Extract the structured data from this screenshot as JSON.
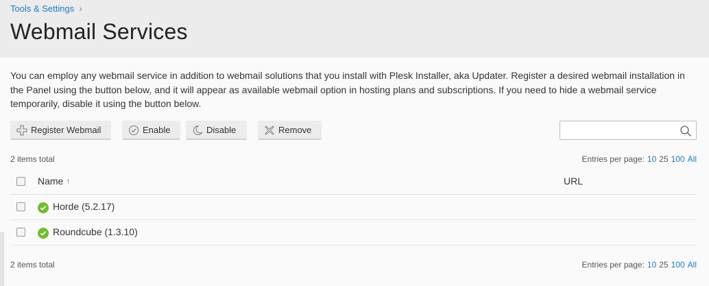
{
  "breadcrumb": {
    "items": [
      "Tools & Settings"
    ]
  },
  "page": {
    "title": "Webmail Services"
  },
  "description": "You can employ any webmail service in addition to webmail solutions that you install with Plesk Installer, aka Updater. Register a desired webmail installation in the Panel using the button below, and it will appear as available webmail option in hosting plans and subscriptions. If you need to hide a webmail service temporarily, disable it using the button below.",
  "toolbar": {
    "register_label": "Register Webmail",
    "enable_label": "Enable",
    "disable_label": "Disable",
    "remove_label": "Remove"
  },
  "search": {
    "value": "",
    "placeholder": ""
  },
  "list": {
    "total_text": "2 items total",
    "per_page_label": "Entries per page:",
    "per_page_options": [
      "10",
      "25",
      "100",
      "All"
    ],
    "columns": {
      "name": "Name",
      "name_sort_icon": "arrow-up-icon",
      "url": "URL"
    },
    "rows": [
      {
        "name": "Horde (5.2.17)",
        "status_icon": "enabled-check-icon",
        "url": ""
      },
      {
        "name": "Roundcube (1.3.10)",
        "status_icon": "enabled-check-icon",
        "url": ""
      }
    ]
  },
  "colors": {
    "accent": "#1d7ac1",
    "enabled": "#6fbf2b",
    "header_bg": "#ececec"
  }
}
